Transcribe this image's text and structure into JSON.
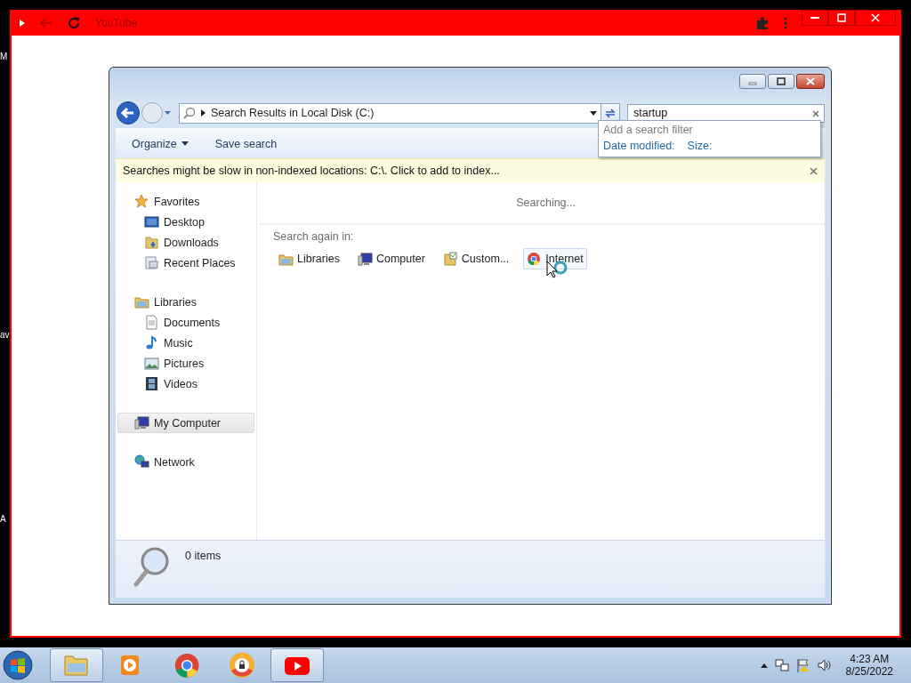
{
  "desktop_labels": [
    "M",
    "av",
    "A"
  ],
  "browser": {
    "title": "YouTube"
  },
  "explorer": {
    "address": "Search Results in Local Disk (C:)",
    "search": {
      "value": "startup"
    },
    "toolbar": [
      {
        "label": "Organize",
        "kind": "menu"
      },
      {
        "label": "Save search",
        "kind": "button"
      }
    ],
    "filter_popup": {
      "heading": "Add a search filter",
      "filters": [
        "Date modified:",
        "Size:"
      ]
    },
    "info_bar": "Searches might be slow in non-indexed locations: C:\\. Click to add to index...",
    "nav": [
      {
        "label": "Favorites",
        "kind": "star",
        "selected": false,
        "children": [
          {
            "label": "Desktop",
            "kind": "desktop",
            "selected": false
          },
          {
            "label": "Downloads",
            "kind": "downloads",
            "selected": false
          },
          {
            "label": "Recent Places",
            "kind": "recent",
            "selected": false
          }
        ]
      },
      {
        "label": "Libraries",
        "kind": "libraries",
        "selected": false,
        "children": [
          {
            "label": "Documents",
            "kind": "documents",
            "selected": false
          },
          {
            "label": "Music",
            "kind": "music",
            "selected": false
          },
          {
            "label": "Pictures",
            "kind": "pictures",
            "selected": false
          },
          {
            "label": "Videos",
            "kind": "videos",
            "selected": false
          }
        ]
      },
      {
        "label": "My Computer",
        "kind": "computer",
        "selected": true
      },
      {
        "label": "Network",
        "kind": "network",
        "selected": false
      }
    ],
    "status": "Searching...",
    "search_again": {
      "label": "Search again in:",
      "locations": [
        {
          "label": "Libraries",
          "kind": "libraries",
          "hovered": false
        },
        {
          "label": "Computer",
          "kind": "computer",
          "hovered": false
        },
        {
          "label": "Custom...",
          "kind": "custom",
          "hovered": false
        },
        {
          "label": "Internet",
          "kind": "internet",
          "hovered": true
        }
      ]
    },
    "status_bar": "0 items"
  },
  "taskbar": {
    "apps": [
      {
        "kind": "explorer",
        "highlighted": true
      },
      {
        "kind": "media",
        "highlighted": false
      },
      {
        "kind": "chrome",
        "highlighted": false
      },
      {
        "kind": "lockbrowser",
        "highlighted": false
      },
      {
        "kind": "youtube",
        "highlighted": true
      }
    ],
    "clock": {
      "time": "4:23 AM",
      "date": "8/25/2022"
    }
  }
}
